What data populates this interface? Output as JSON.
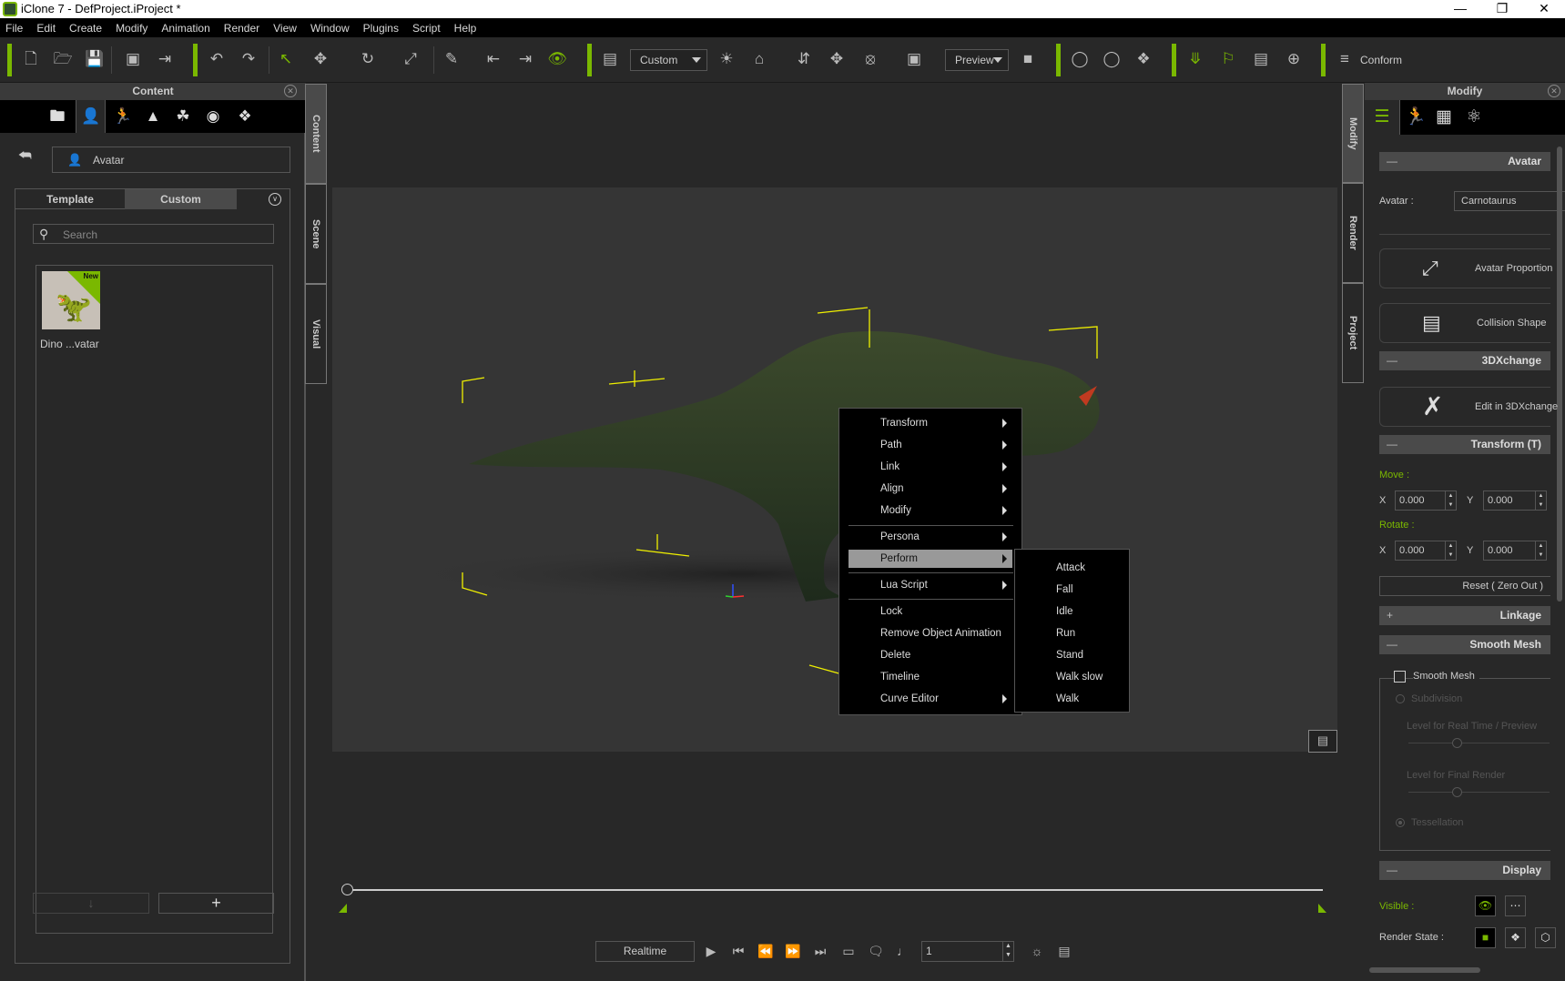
{
  "window": {
    "title": "iClone 7 - DefProject.iProject *",
    "controls": [
      "minimize",
      "maximize",
      "close"
    ]
  },
  "menubar": [
    "File",
    "Edit",
    "Create",
    "Modify",
    "Animation",
    "Render",
    "View",
    "Window",
    "Plugins",
    "Script",
    "Help"
  ],
  "toolbar": {
    "view_preset": "Custom",
    "render_mode": "Preview",
    "conform_label": "Conform",
    "icons": [
      "new-file",
      "open-folder",
      "save",
      "preview-window",
      "export",
      "undo",
      "redo",
      "select",
      "move",
      "rotate",
      "scale",
      "link",
      "align-left",
      "align-right",
      "visibility",
      "layout",
      "light",
      "home",
      "fit-vertical",
      "fit-all",
      "camera-orbit",
      "frame-object",
      "video-camera",
      "bone-edit",
      "bone-view",
      "cubes",
      "motion-puppet",
      "flag",
      "timeline-clip",
      "pose-link"
    ]
  },
  "content_panel": {
    "title": "Content",
    "icon_tabs": [
      "project",
      "avatar",
      "motion",
      "stage",
      "prop",
      "media",
      "package"
    ],
    "breadcrumb": "Avatar",
    "tabs": [
      {
        "label": "Template"
      },
      {
        "label": "Custom",
        "active": true
      }
    ],
    "search_placeholder": "Search",
    "items": [
      {
        "label": "Dino ...vatar",
        "badge": "New"
      }
    ]
  },
  "left_side_tabs": [
    "Content",
    "Scene",
    "Visual"
  ],
  "right_side_tabs": [
    "Modify",
    "Render",
    "Project"
  ],
  "context_menu": {
    "items": [
      {
        "label": "Transform",
        "submenu": true
      },
      {
        "label": "Path",
        "submenu": true
      },
      {
        "label": "Link",
        "submenu": true
      },
      {
        "label": "Align",
        "submenu": true
      },
      {
        "label": "Modify",
        "submenu": true
      },
      {
        "label": "Persona",
        "submenu": true
      },
      {
        "label": "Perform",
        "submenu": true,
        "highlighted": true
      },
      {
        "label": "Lua Script",
        "submenu": true
      },
      {
        "label": "Lock",
        "submenu": false
      },
      {
        "label": "Remove Object  Animation",
        "submenu": false
      },
      {
        "label": "Delete",
        "submenu": false
      },
      {
        "label": "Timeline",
        "submenu": false
      },
      {
        "label": "Curve Editor",
        "submenu": true
      }
    ],
    "perform_submenu": [
      "Attack",
      "Fall",
      "Idle",
      "Run",
      "Stand",
      "Walk slow",
      "Walk"
    ]
  },
  "playback": {
    "mode": "Realtime",
    "frame": "1",
    "timeline_position": 0
  },
  "modify_panel": {
    "title": "Modify",
    "sections": {
      "avatar": {
        "title": "Avatar",
        "field_label": "Avatar :",
        "value": "Carnotaurus",
        "buttons": [
          "Avatar Proportion",
          "Collision Shape"
        ]
      },
      "xchange": {
        "title": "3DXchange",
        "button": "Edit in 3DXchange"
      },
      "transform": {
        "title": "Transform  (T)",
        "move_label": "Move :",
        "rotate_label": "Rotate :",
        "move": {
          "x": "0.000",
          "y": "0.000"
        },
        "rotate": {
          "x": "0.000",
          "y": "0.000"
        },
        "reset": "Reset ( Zero Out )"
      },
      "linkage": {
        "title": "Linkage"
      },
      "smooth_mesh": {
        "title": "Smooth Mesh",
        "checkbox_label": "Smooth Mesh",
        "checked": false,
        "subdivision": "Subdivision",
        "level_realtime": "Level for Real Time / Preview",
        "level_final": "Level for Final Render",
        "tessellation": "Tessellation"
      },
      "display": {
        "title": "Display",
        "visible_label": "Visible :",
        "render_state_label": "Render State  :"
      }
    }
  },
  "colors": {
    "accent": "#7ab800",
    "highlight": "#999999",
    "bg": "#282828"
  }
}
